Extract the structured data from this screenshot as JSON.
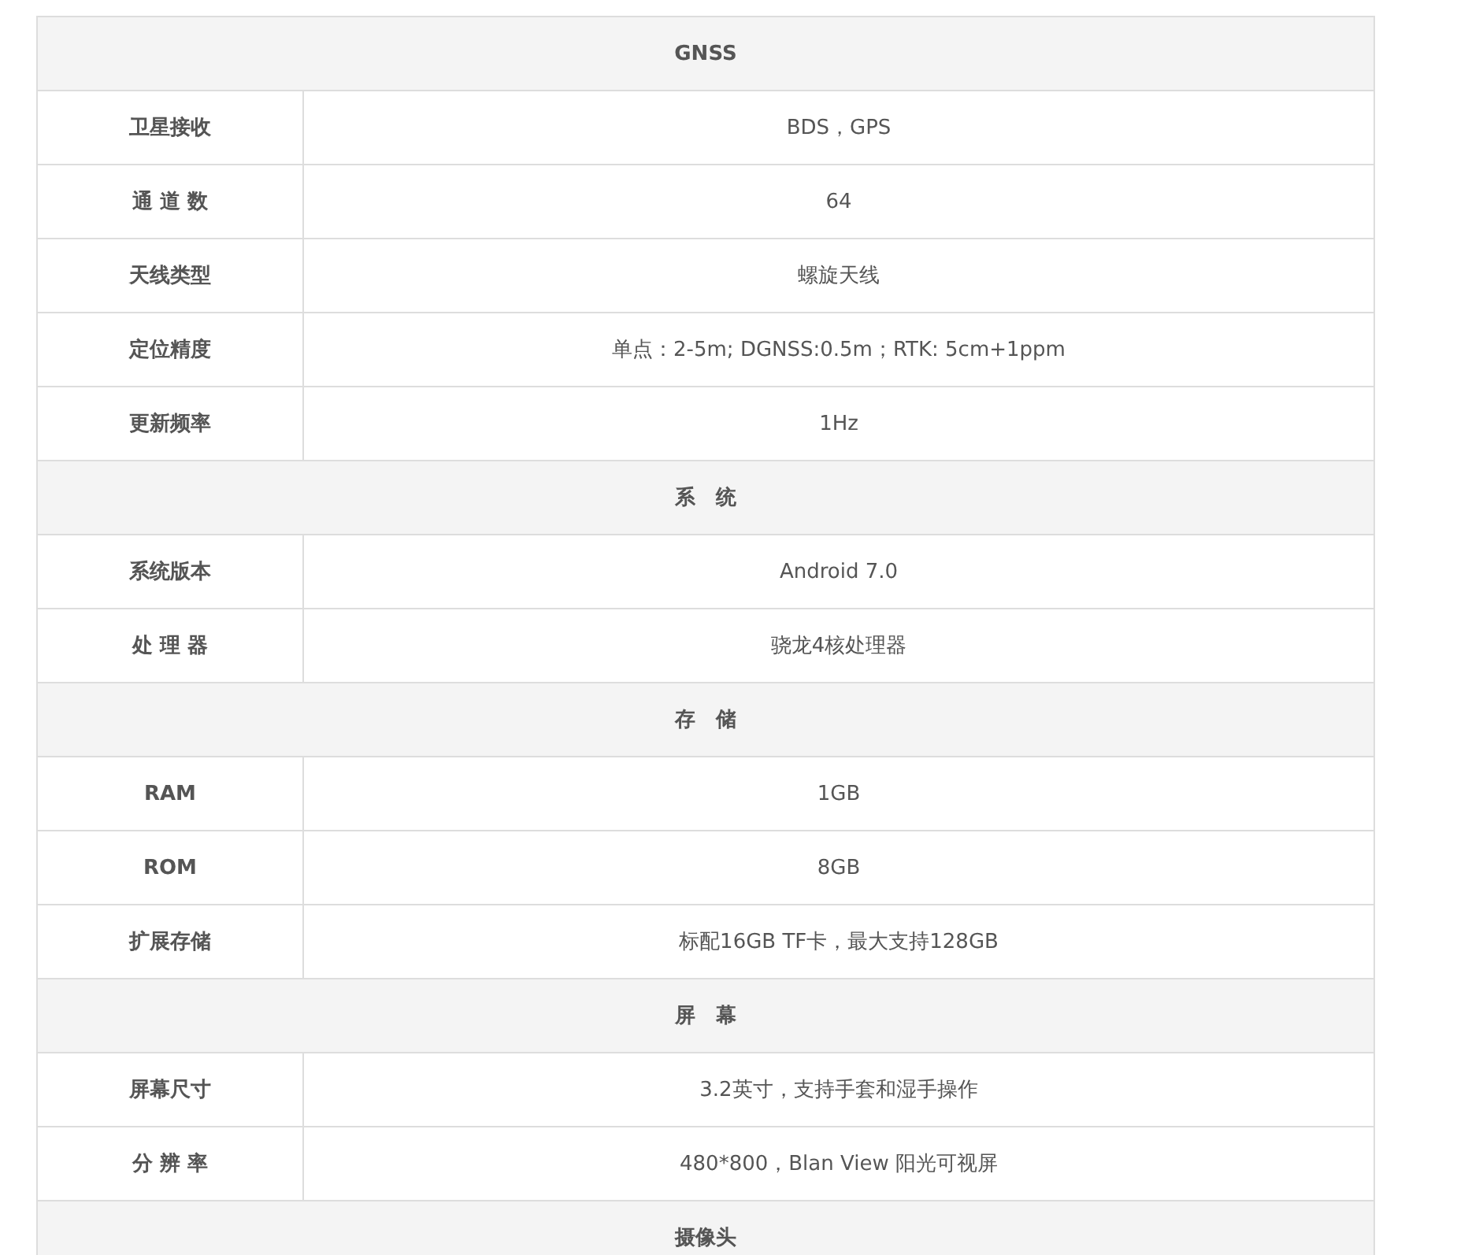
{
  "sections": [
    {
      "title": "GNSS",
      "rows": [
        {
          "label": "卫星接收",
          "value": "BDS，GPS"
        },
        {
          "label": "通 道 数",
          "value": "64"
        },
        {
          "label": "天线类型",
          "value": "螺旋天线"
        },
        {
          "label": "定位精度",
          "value": "单点：2-5m; DGNSS:0.5m；RTK: 5cm+1ppm"
        },
        {
          "label": "更新频率",
          "value": "1Hz"
        }
      ]
    },
    {
      "title": "系　统",
      "rows": [
        {
          "label": "系统版本",
          "value": "Android 7.0"
        },
        {
          "label": "处 理 器",
          "value": "骁龙4核处理器"
        }
      ]
    },
    {
      "title": "存　储",
      "rows": [
        {
          "label": "RAM",
          "value": "1GB"
        },
        {
          "label": "ROM",
          "value": "8GB"
        },
        {
          "label": "扩展存储",
          "value": "标配16GB TF卡，最大支持128GB"
        }
      ]
    },
    {
      "title": "屏　幕",
      "rows": [
        {
          "label": "屏幕尺寸",
          "value": "3.2英寸，支持手套和湿手操作"
        },
        {
          "label": "分 辨 率",
          "value": "480*800，Blan View 阳光可视屏"
        }
      ]
    },
    {
      "title": "摄像头"
    }
  ]
}
